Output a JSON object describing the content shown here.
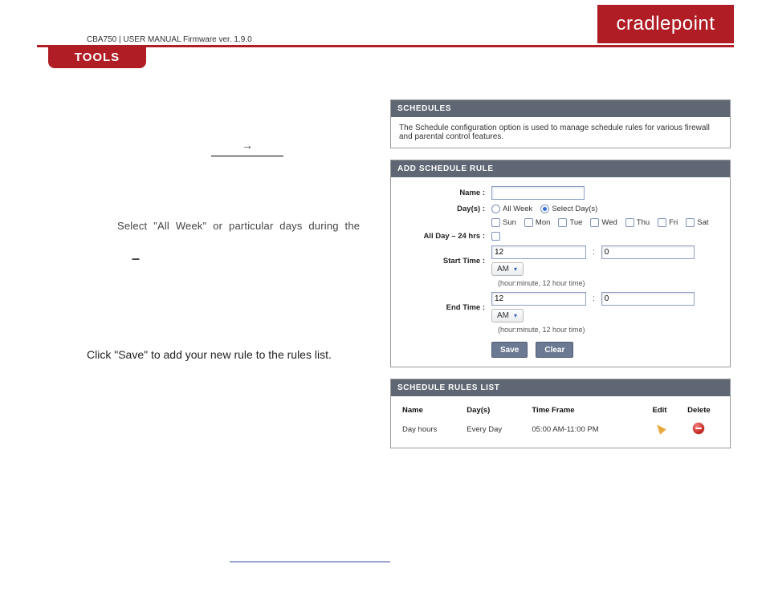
{
  "brand": "cradlepoint",
  "docTitle": "CBA750 | USER MANUAL Firmware ver. 1.9.0",
  "tabLabel": "TOOLS",
  "left": {
    "arrow": "→",
    "daysLine": "Select  \"All  Week\"  or  particular  days  during  the",
    "dash": "–",
    "saveLine": "Click \"Save\" to add your new rule to the rules list."
  },
  "schedules": {
    "title": "SCHEDULES",
    "desc": "The Schedule configuration option is used to manage schedule rules for various firewall and parental control features."
  },
  "addRule": {
    "title": "ADD SCHEDULE RULE",
    "labels": {
      "name": "Name :",
      "days": "Day(s) :",
      "allDay": "All Day – 24 hrs :",
      "start": "Start Time :",
      "end": "End Time :"
    },
    "radios": {
      "allWeek": "All Week",
      "selectDays": "Select Day(s)"
    },
    "dayNames": [
      "Sun",
      "Mon",
      "Tue",
      "Wed",
      "Thu",
      "Fri",
      "Sat"
    ],
    "start": {
      "hour": "12",
      "minute": "0",
      "ampm": "AM"
    },
    "end": {
      "hour": "12",
      "minute": "0",
      "ampm": "AM"
    },
    "hint": "(hour:minute, 12 hour time)",
    "buttons": {
      "save": "Save",
      "clear": "Clear"
    }
  },
  "rulesList": {
    "title": "SCHEDULE RULES LIST",
    "headers": {
      "name": "Name",
      "days": "Day(s)",
      "time": "Time Frame",
      "edit": "Edit",
      "del": "Delete"
    },
    "rows": [
      {
        "name": "Day hours",
        "days": "Every Day",
        "time": "05:00 AM-11:00 PM"
      }
    ]
  }
}
